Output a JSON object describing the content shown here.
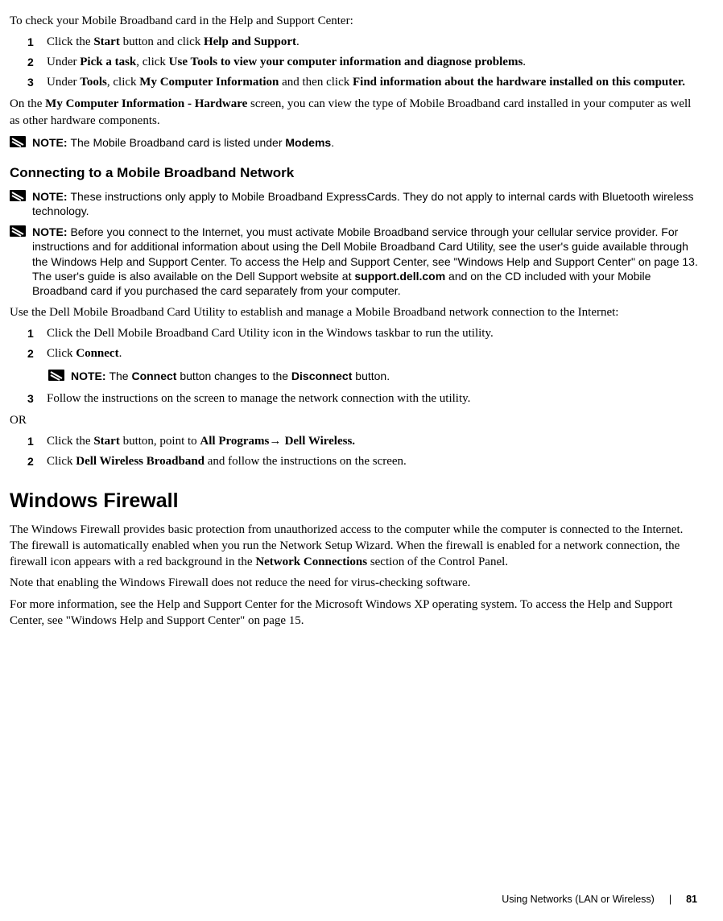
{
  "intro": "To check your Mobile Broadband card in the Help and Support Center:",
  "steps_a": [
    {
      "n": "1",
      "pre": "Click the ",
      "b1": "Start",
      "mid": " button and click ",
      "b2": "Help and Support",
      "post": "."
    },
    {
      "n": "2",
      "pre": "Under ",
      "b1": "Pick a task",
      "mid": ", click ",
      "b2": "Use Tools to view your computer information and diagnose problems",
      "post": "."
    },
    {
      "n": "3",
      "pre": "Under ",
      "b1": "Tools",
      "mid": ", click ",
      "b2": "My Computer Information",
      "mid2": " and then click ",
      "b3": "Find information about the hardware installed on this computer.",
      "post": ""
    }
  ],
  "after_a_pre": "On the ",
  "after_a_b": "My Computer Information - Hardware",
  "after_a_post": " screen, you can view the type of Mobile Broadband card installed in your computer as well as other hardware components.",
  "note1_lbl": "NOTE: ",
  "note1_pre": "The Mobile Broadband card is listed under ",
  "note1_b": "Modems",
  "note1_post": ".",
  "subhead": "Connecting to a Mobile Broadband Network",
  "note2_lbl": "NOTE: ",
  "note2_body": "These instructions only apply to Mobile Broadband ExpressCards. They do not apply to internal cards with Bluetooth wireless technology.",
  "note3_lbl": "NOTE: ",
  "note3_pre": "Before you connect to the Internet, you must activate Mobile Broadband service through your cellular service provider. For instructions and for additional information about using the Dell Mobile Broadband Card Utility, see the user's guide available through the Windows Help and Support Center. To access the Help and Support Center, see \"Windows Help and Support Center\" on page 13. The user's guide is also available on the Dell Support website at ",
  "note3_b": "support.dell.com",
  "note3_post": " and on the CD included with your Mobile Broadband card if you purchased the card separately from your computer.",
  "use_para": "Use the Dell Mobile Broadband Card Utility to establish and manage a Mobile Broadband network connection to the Internet:",
  "steps_b": [
    {
      "n": "1",
      "text": "Click the Dell Mobile Broadband Card Utility icon in the Windows taskbar to run the utility."
    },
    {
      "n": "2",
      "pre": "Click ",
      "b1": "Connect",
      "post": "."
    }
  ],
  "inner_note_lbl": "NOTE: ",
  "inner_note_pre": "The ",
  "inner_note_b1": "Connect",
  "inner_note_mid": " button changes to the ",
  "inner_note_b2": "Disconnect",
  "inner_note_post": " button.",
  "step_b3_n": "3",
  "step_b3": "Follow the instructions on the screen to manage the network connection with the utility.",
  "or": "OR",
  "steps_c": [
    {
      "n": "1",
      "pre": "Click the ",
      "b1": "Start",
      "mid": " button, point to ",
      "b2": "All Programs",
      "arrow": "→ ",
      "b3": "Dell Wireless.",
      "post": ""
    },
    {
      "n": "2",
      "pre": "Click ",
      "b1": "Dell Wireless Broadband",
      "post": " and follow the instructions on the screen."
    }
  ],
  "head2": "Windows Firewall",
  "fw_p1_pre": "The Windows Firewall provides basic protection from unauthorized access to the computer while the computer is connected to the Internet. The firewall is automatically enabled when you run the Network Setup Wizard. When the firewall is enabled for a network connection, the firewall icon appears with a red background in the ",
  "fw_p1_b": "Network Connections",
  "fw_p1_post": " section of the Control Panel.",
  "fw_p2": "Note that enabling the Windows Firewall does not reduce the need for virus-checking software.",
  "fw_p3": "For more information, see the Help and Support Center for the Microsoft Windows XP operating system. To access the Help and Support Center, see \"Windows Help and Support Center\" on page 15.",
  "footer_section": "Using Networks (LAN or Wireless)",
  "footer_page": "81"
}
